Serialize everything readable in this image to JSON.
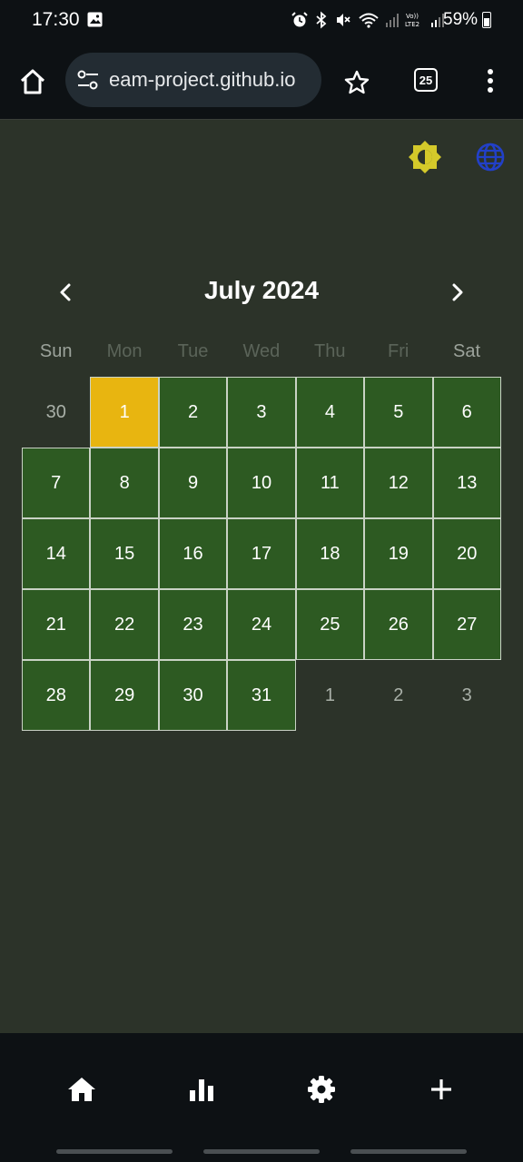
{
  "status": {
    "time": "17:30",
    "battery": "59%",
    "icons": [
      "gallery-icon",
      "alarm-icon",
      "bluetooth-icon",
      "mute-icon",
      "wifi-icon",
      "volte-icon",
      "signal-icon",
      "battery-icon"
    ]
  },
  "browser": {
    "url": "eam-project.github.io",
    "tab_count": "25"
  },
  "calendar": {
    "month_title": "July 2024",
    "weekdays": [
      "Sun",
      "Mon",
      "Tue",
      "Wed",
      "Thu",
      "Fri",
      "Sat"
    ],
    "days": [
      {
        "label": "30",
        "in_month": false
      },
      {
        "label": "1",
        "in_month": true,
        "today": true
      },
      {
        "label": "2",
        "in_month": true
      },
      {
        "label": "3",
        "in_month": true
      },
      {
        "label": "4",
        "in_month": true
      },
      {
        "label": "5",
        "in_month": true
      },
      {
        "label": "6",
        "in_month": true
      },
      {
        "label": "7",
        "in_month": true
      },
      {
        "label": "8",
        "in_month": true
      },
      {
        "label": "9",
        "in_month": true
      },
      {
        "label": "10",
        "in_month": true
      },
      {
        "label": "11",
        "in_month": true
      },
      {
        "label": "12",
        "in_month": true
      },
      {
        "label": "13",
        "in_month": true
      },
      {
        "label": "14",
        "in_month": true
      },
      {
        "label": "15",
        "in_month": true
      },
      {
        "label": "16",
        "in_month": true
      },
      {
        "label": "17",
        "in_month": true
      },
      {
        "label": "18",
        "in_month": true
      },
      {
        "label": "19",
        "in_month": true
      },
      {
        "label": "20",
        "in_month": true
      },
      {
        "label": "21",
        "in_month": true
      },
      {
        "label": "22",
        "in_month": true
      },
      {
        "label": "23",
        "in_month": true
      },
      {
        "label": "24",
        "in_month": true
      },
      {
        "label": "25",
        "in_month": true
      },
      {
        "label": "26",
        "in_month": true
      },
      {
        "label": "27",
        "in_month": true
      },
      {
        "label": "28",
        "in_month": true
      },
      {
        "label": "29",
        "in_month": true
      },
      {
        "label": "30",
        "in_month": true
      },
      {
        "label": "31",
        "in_month": true
      },
      {
        "label": "1",
        "in_month": false
      },
      {
        "label": "2",
        "in_month": false
      },
      {
        "label": "3",
        "in_month": false
      }
    ]
  },
  "nav": {
    "items": [
      "home-icon",
      "chart-icon",
      "settings-icon",
      "add-icon"
    ]
  },
  "colors": {
    "background": "#2c3329",
    "in_month_cell": "#2d5a22",
    "today_cell": "#e8b510",
    "theme_icon": "#d4c92a",
    "language_icon": "#2240c8"
  }
}
